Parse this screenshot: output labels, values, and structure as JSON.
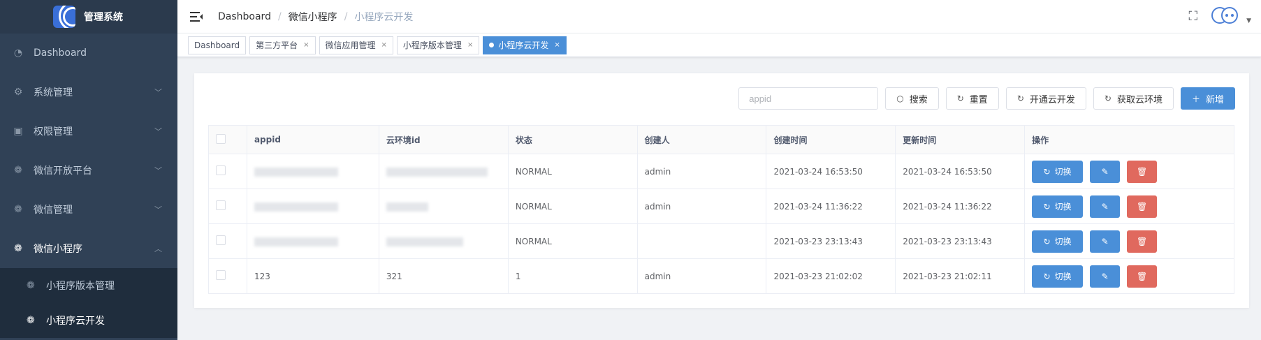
{
  "app": {
    "title": "管理系统"
  },
  "sidebar": {
    "items": [
      {
        "label": "Dashboard",
        "icon": "dashboard-icon"
      },
      {
        "label": "系统管理",
        "icon": "gear-icon"
      },
      {
        "label": "权限管理",
        "icon": "chip-icon"
      },
      {
        "label": "微信开放平台",
        "icon": "wechat-icon"
      },
      {
        "label": "微信管理",
        "icon": "wechat-icon"
      },
      {
        "label": "微信小程序",
        "icon": "wechat-icon"
      }
    ],
    "submenu": [
      {
        "label": "小程序版本管理",
        "icon": "wechat-icon"
      },
      {
        "label": "小程序云开发",
        "icon": "wechat-icon"
      }
    ]
  },
  "breadcrumb": [
    "Dashboard",
    "微信小程序",
    "小程序云开发"
  ],
  "tags": [
    {
      "label": "Dashboard"
    },
    {
      "label": "第三方平台"
    },
    {
      "label": "微信应用管理"
    },
    {
      "label": "小程序版本管理"
    },
    {
      "label": "小程序云开发"
    }
  ],
  "toolbar": {
    "search_placeholder": "appid",
    "search_label": "搜索",
    "reset_label": "重置",
    "open_cloud_label": "开通云开发",
    "fetch_env_label": "获取云环境",
    "add_label": "新增"
  },
  "table": {
    "columns": [
      "appid",
      "云环境id",
      "状态",
      "创建人",
      "创建时间",
      "更新时间",
      "操作"
    ],
    "rows": [
      {
        "appid": "",
        "env_id": "",
        "status": "NORMAL",
        "creator": "admin",
        "created": "2021-03-24 16:53:50",
        "updated": "2021-03-24 16:53:50"
      },
      {
        "appid": "",
        "env_id": "",
        "status": "NORMAL",
        "creator": "admin",
        "created": "2021-03-24 11:36:22",
        "updated": "2021-03-24 11:36:22"
      },
      {
        "appid": "",
        "env_id": "",
        "status": "NORMAL",
        "creator": "",
        "created": "2021-03-23 23:13:43",
        "updated": "2021-03-23 23:13:43"
      },
      {
        "appid": "123",
        "env_id": "321",
        "status": "1",
        "creator": "admin",
        "created": "2021-03-23 21:02:02",
        "updated": "2021-03-23 21:02:11"
      }
    ],
    "switch_label": "切换"
  }
}
